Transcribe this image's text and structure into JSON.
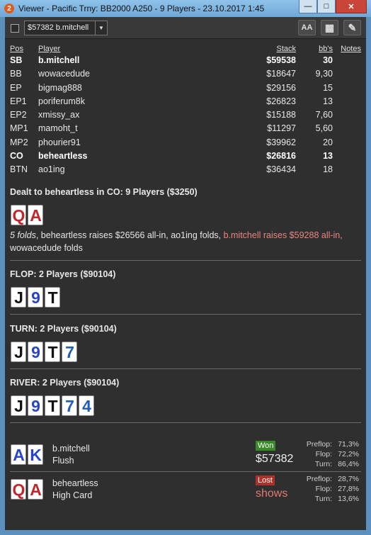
{
  "window": {
    "icon_label": "2",
    "title": "Viewer - Pacific Trny: BB2000 A250 - 9 Players - 23.10.2017 1:45",
    "minimize": "—",
    "maximize": "□",
    "close": "✕"
  },
  "toolbar": {
    "selected_player": "$57382 b.mitchell",
    "dropdown_arrow": "▼",
    "font_button": "AA",
    "grid_button": "▦",
    "edit_button": "✎"
  },
  "table": {
    "headers": {
      "pos": "Pos",
      "player": "Player",
      "stack": "Stack",
      "bbs": "bb's",
      "notes": "Notes"
    },
    "rows": [
      {
        "pos": "SB",
        "player": "b.mitchell",
        "stack": "$59538",
        "bbs": "30",
        "bold": true
      },
      {
        "pos": "BB",
        "player": "wowacedude",
        "stack": "$18647",
        "bbs": "9,30",
        "bold": false
      },
      {
        "pos": "EP",
        "player": "bigmag888",
        "stack": "$29156",
        "bbs": "15",
        "bold": false
      },
      {
        "pos": "EP1",
        "player": "poriferum8k",
        "stack": "$26823",
        "bbs": "13",
        "bold": false
      },
      {
        "pos": "EP2",
        "player": "xmissy_ax",
        "stack": "$15188",
        "bbs": "7,60",
        "bold": false
      },
      {
        "pos": "MP1",
        "player": "mamoht_t",
        "stack": "$11297",
        "bbs": "5,60",
        "bold": false
      },
      {
        "pos": "MP2",
        "player": "phourier91",
        "stack": "$39962",
        "bbs": "20",
        "bold": false
      },
      {
        "pos": "CO",
        "player": "beheartless",
        "stack": "$26816",
        "bbs": "13",
        "bold": true
      },
      {
        "pos": "BTN",
        "player": "ao1ing",
        "stack": "$36434",
        "bbs": "18",
        "bold": false
      }
    ]
  },
  "preflop": {
    "title": "Dealt to beheartless in CO: 9 Players ($3250)",
    "cards": [
      {
        "rank": "Q",
        "suit": "h"
      },
      {
        "rank": "A",
        "suit": "h"
      }
    ],
    "action_italic": "5 folds",
    "action_normal": ", beheartless raises $26566 all-in, ao1ing folds, ",
    "action_red": "b.mitchell raises $59288 all-in,",
    "action_end": "wowacedude folds"
  },
  "flop": {
    "title": "FLOP: 2 Players ($90104)",
    "cards": [
      {
        "rank": "J",
        "suit": "s"
      },
      {
        "rank": "9",
        "suit": "d"
      },
      {
        "rank": "T",
        "suit": "s"
      }
    ]
  },
  "turn": {
    "title": "TURN: 2 Players ($90104)",
    "cards": [
      {
        "rank": "J",
        "suit": "s"
      },
      {
        "rank": "9",
        "suit": "d"
      },
      {
        "rank": "T",
        "suit": "s"
      },
      {
        "rank": "7",
        "suit": "c"
      }
    ]
  },
  "river": {
    "title": "RIVER: 2 Players ($90104)",
    "cards": [
      {
        "rank": "J",
        "suit": "s"
      },
      {
        "rank": "9",
        "suit": "d"
      },
      {
        "rank": "T",
        "suit": "s"
      },
      {
        "rank": "7",
        "suit": "c"
      },
      {
        "rank": "4",
        "suit": "c"
      }
    ]
  },
  "results": [
    {
      "cards": [
        {
          "rank": "A",
          "suit": "d"
        },
        {
          "rank": "K",
          "suit": "d"
        }
      ],
      "name": "b.mitchell",
      "hand": "Flush",
      "badge": "Won",
      "amount": "$57382",
      "stats": [
        {
          "label": "Preflop:",
          "value": "71,3%"
        },
        {
          "label": "Flop:",
          "value": "72,2%"
        },
        {
          "label": "Turn:",
          "value": "86,4%"
        }
      ]
    },
    {
      "cards": [
        {
          "rank": "Q",
          "suit": "h"
        },
        {
          "rank": "A",
          "suit": "h"
        }
      ],
      "name": "beheartless",
      "hand": "High Card",
      "badge": "Lost",
      "amount": "shows",
      "stats": [
        {
          "label": "Preflop:",
          "value": "28,7%"
        },
        {
          "label": "Flop:",
          "value": "27,8%"
        },
        {
          "label": "Turn:",
          "value": "13,6%"
        }
      ]
    }
  ],
  "colors": {
    "hearts": "#c0282c",
    "diamonds": "#2a44c9",
    "spades": "#111111",
    "clubs": "#1f5db8",
    "won_badge": "#3b8a2a",
    "lost_badge": "#b0312a",
    "highlight_action": "#e8867e"
  }
}
